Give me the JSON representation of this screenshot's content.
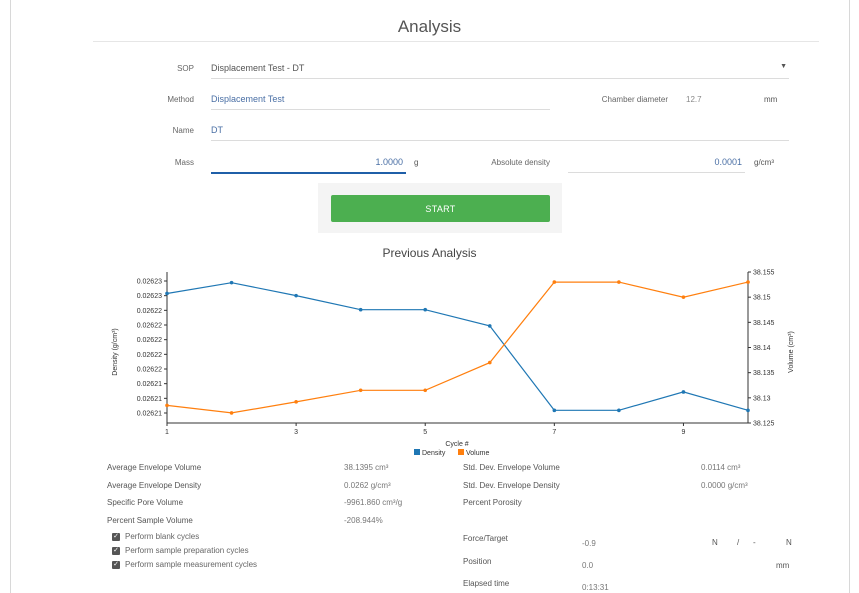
{
  "page": {
    "title": "Analysis"
  },
  "form": {
    "sop": {
      "label": "SOP",
      "value": "Displacement Test - DT"
    },
    "method": {
      "label": "Method",
      "value": "Displacement Test"
    },
    "chamber": {
      "label": "Chamber diameter",
      "value": "12.7",
      "unit": "mm"
    },
    "name": {
      "label": "Name",
      "value": "DT"
    },
    "mass": {
      "label": "Mass",
      "value": "1.0000",
      "unit": "g"
    },
    "absolute_density": {
      "label": "Absolute density",
      "value": "0.0001",
      "unit": "g/cm³"
    }
  },
  "start_label": "START",
  "previous_title": "Previous Analysis",
  "chart_data": {
    "type": "line",
    "xlabel": "Cycle #",
    "ylabel_left": "Density (g/cm³)",
    "ylabel_right": "Volume (cm³)",
    "x": [
      1,
      2,
      3,
      4,
      5,
      6,
      7,
      8,
      9,
      10
    ],
    "x_ticks": [
      "1",
      "3",
      "5",
      "7",
      "9"
    ],
    "left_ticks": [
      "0.02623",
      "0.02623",
      "0.02622",
      "0.02622",
      "0.02622",
      "0.02622",
      "0.02622",
      "0.02621",
      "0.02621",
      "0.02621"
    ],
    "right_ticks": [
      "38.155",
      "38.15",
      "38.145",
      "38.14",
      "38.135",
      "38.13",
      "38.125"
    ],
    "right_ylim": [
      38.125,
      38.155
    ],
    "series": [
      {
        "name": "Density",
        "color": "#1f77b4",
        "axis": "left",
        "values": [
          0.026228,
          0.026229,
          0.0262278,
          0.0262265,
          0.0262265,
          0.026225,
          0.0262172,
          0.0262172,
          0.0262189,
          0.0262172
        ]
      },
      {
        "name": "Volume",
        "color": "#ff7f0e",
        "axis": "right",
        "values": [
          38.1285,
          38.127,
          38.1292,
          38.1315,
          38.1315,
          38.137,
          38.153,
          38.153,
          38.15,
          38.153
        ]
      }
    ]
  },
  "stats_left": [
    {
      "label": "Average Envelope Volume",
      "value": "38.1395 cm³"
    },
    {
      "label": "Average Envelope Density",
      "value": "0.0262 g/cm³"
    },
    {
      "label": "Specific Pore Volume",
      "value": "-9961.860 cm³/g"
    },
    {
      "label": "Percent Sample Volume",
      "value": "-208.944%"
    }
  ],
  "stats_right": [
    {
      "label": "Std. Dev. Envelope Volume",
      "value": "0.0114 cm³"
    },
    {
      "label": "Std. Dev. Envelope Density",
      "value": "0.0000 g/cm³"
    },
    {
      "label": "Percent Porosity",
      "value": ""
    }
  ],
  "checkboxes": [
    {
      "label": "Perform blank cycles",
      "checked": true
    },
    {
      "label": "Perform sample preparation cycles",
      "checked": true
    },
    {
      "label": "Perform sample measurement cycles",
      "checked": true
    }
  ],
  "live": {
    "force": {
      "label": "Force/Target",
      "value": "-0.9",
      "unit1": "N",
      "sep": "/",
      "target": "-",
      "unit2": "N"
    },
    "position": {
      "label": "Position",
      "value": "0.0",
      "unit": "mm"
    },
    "elapsed": {
      "label": "Elapsed time",
      "value": "0:13:31"
    }
  }
}
